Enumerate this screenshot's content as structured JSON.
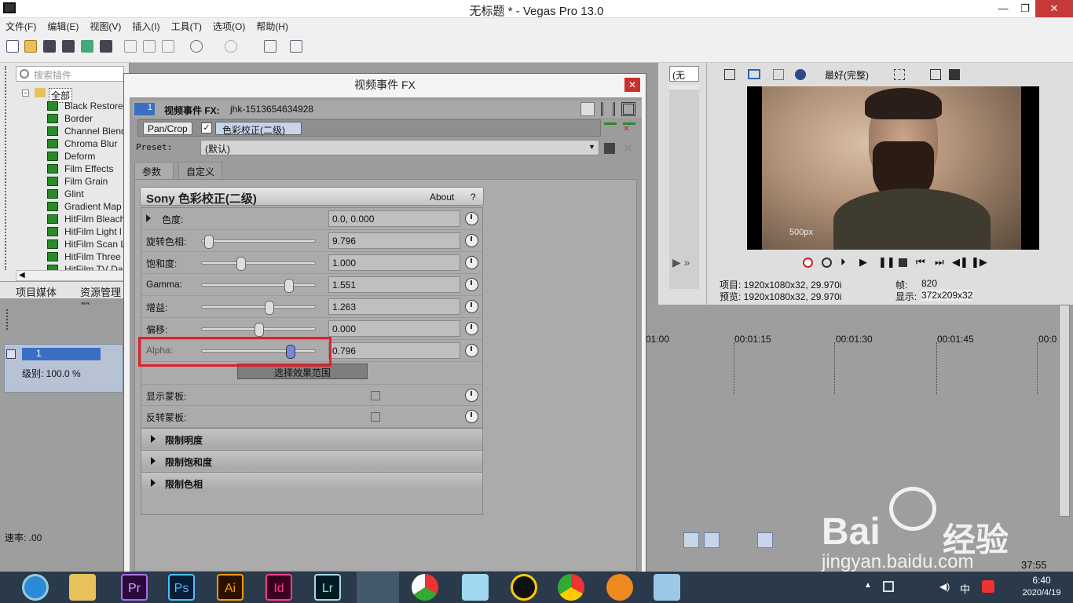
{
  "window": {
    "title": "无标题 * - Vegas Pro 13.0"
  },
  "menu": [
    "文件(F)",
    "编辑(E)",
    "视图(V)",
    "插入(I)",
    "工具(T)",
    "选项(O)",
    "帮助(H)"
  ],
  "plugins": {
    "search_placeholder": "搜索插件",
    "root": "全部",
    "items": [
      "Black Restore",
      "Border",
      "Channel Blend",
      "Chroma Blur",
      "Deform",
      "Film Effects",
      "Film Grain",
      "Glint",
      "Gradient Map",
      "HitFilm Bleach",
      "HitFilm Light l",
      "HitFilm Scan L",
      "HitFilm Three",
      "HitFilm TV Da"
    ]
  },
  "left_tabs": [
    "项目媒体",
    "资源管理器"
  ],
  "fx_window": {
    "title": "视频事件 FX",
    "header_label": "视频事件 FX:",
    "event_name": "jhk-1513654634928",
    "track_num": "1",
    "chain": [
      "Pan/Crop",
      "色彩校正(二级)"
    ],
    "preset_label": "Preset:",
    "preset_value": "(默认)",
    "tabs": [
      "参数",
      "自定义"
    ],
    "plugin_name": "Sony 色彩校正(二级)",
    "about": "About",
    "help": "?",
    "params": [
      {
        "label": "色度:",
        "value": "0.0, 0.000"
      },
      {
        "label": "旋转色相:",
        "value": "9.796",
        "slider": 0.02
      },
      {
        "label": "饱和度:",
        "value": "1.000",
        "slider": 0.33
      },
      {
        "label": "Gamma:",
        "value": "1.551",
        "slider": 0.78
      },
      {
        "label": "增益:",
        "value": "1.263",
        "slider": 0.6
      },
      {
        "label": "偏移:",
        "value": "0.000",
        "slider": 0.5
      },
      {
        "label": "Alpha:",
        "value": "0.796",
        "slider": 0.8
      }
    ],
    "select_range": "选择效果范围",
    "show_mask": "显示蒙板:",
    "invert_mask": "反转蒙板:",
    "sections": [
      "限制明度",
      "限制饱和度",
      "限制色相"
    ]
  },
  "trimmer": {
    "dropdown": "(无"
  },
  "preview": {
    "quality": "最好(完整)",
    "project": "项目: 1920x1080x32, 29.970i",
    "preview_res": "预览: 1920x1080x32, 29.970i",
    "frame_label": "帧:",
    "frame": "820",
    "display_label": "显示:",
    "display": "372x209x32",
    "watermark": "500px"
  },
  "timeline": {
    "track_num": "1",
    "level": "级别: 100.0 %",
    "rate": "速率: .00",
    "ruler": [
      "01:00",
      "00:01:15",
      "00:01:30",
      "00:01:45",
      "00:0"
    ],
    "status_time": "37:55"
  },
  "taskbar": {
    "apps": [
      "Pr",
      "Ps",
      "Ai",
      "Id",
      "Lr"
    ],
    "ime": "中",
    "time": "6:40",
    "date": "2020/4/19"
  },
  "watermark": {
    "brand": "Bai",
    "brand_cn": "经验",
    "url": "jingyan.baidu.com"
  }
}
